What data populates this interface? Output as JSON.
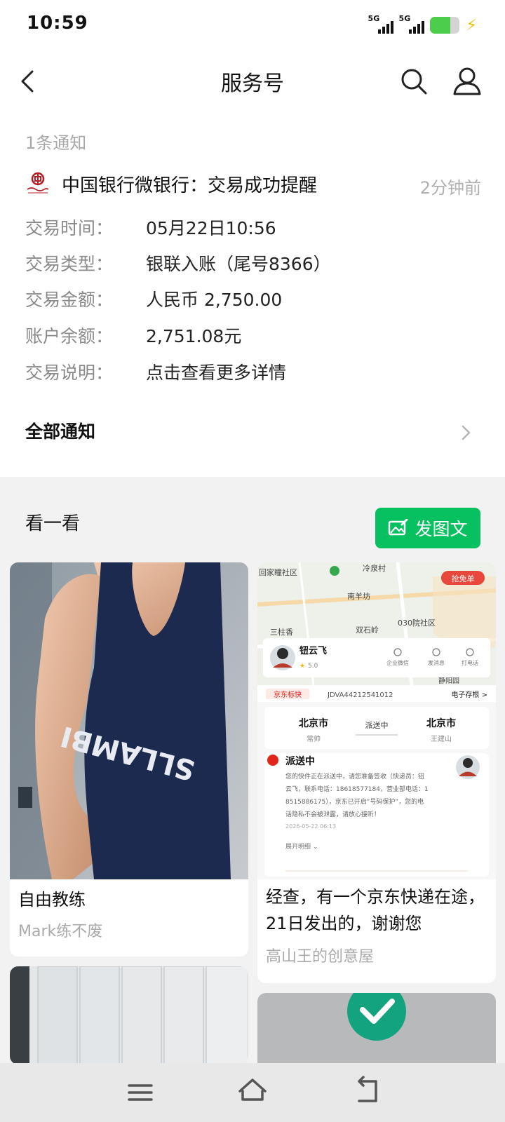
{
  "status_bar": {
    "time": "10:59",
    "sim1_label": "5G",
    "sim2_label": "5G",
    "battery_level": 0.7,
    "battery_color": "#4ccd4c",
    "charging_icon": "lightning-bolt-icon"
  },
  "nav": {
    "title": "服务号",
    "back_icon": "back-arrow-icon",
    "search_icon": "search-icon",
    "profile_icon": "person-icon"
  },
  "notifications": {
    "count_label": "1条通知",
    "message": {
      "title": "中国银行微银行：交易成功提醒",
      "time": "2分钟前",
      "logo_icon": "bank-of-china-logo",
      "fields": [
        {
          "key": "交易时间：",
          "value": "05月22日10:56"
        },
        {
          "key": "交易类型：",
          "value": "银联入账（尾号8366）"
        },
        {
          "key": "交易金额：",
          "value": "人民币 2,750.00"
        },
        {
          "key": "账户余额：",
          "value": "2,751.08元"
        },
        {
          "key": "交易说明：",
          "value": "点击查看更多详情"
        }
      ]
    },
    "all_label": "全部通知"
  },
  "discover": {
    "title": "看一看",
    "post_button_label": "发图文",
    "accent_color": "#07c160",
    "cards": [
      {
        "title": "自由教练",
        "author": "Mark练不废"
      },
      {
        "title": "经查，有一个京东快递在途，21日发出的，谢谢您",
        "author": "高山王的创意屋"
      }
    ]
  },
  "express_screenshot": {
    "map_labels": [
      "回家瞳社区",
      "冷泉村",
      "南羊坊",
      "双石岭",
      "030院社区",
      "三柱香",
      "静阳园"
    ],
    "courier_name": "钮云飞",
    "courier_rating": "5.0",
    "grab_label": "抢免单",
    "actions": [
      "企业微信",
      "发消息",
      "打电话"
    ],
    "brand": "京东标快",
    "waybill": "JDVA44212541012",
    "e_receipt": "电子存根 >",
    "from_city": "北京市",
    "from_person": "常帅",
    "status_pill": "派送中",
    "to_city": "北京市",
    "to_person": "王建山",
    "status_title": "派送中",
    "status_text_lines": [
      "您的快件正在派送中，请您准备签收（快递员：钮",
      "云飞，联系电话：18618577184，营业部电话：1",
      "8515886175），京东已开启“号码保护”，您的电",
      "话隐私不会被泄露，请放心接听！"
    ],
    "status_time": "2026-05-22 06:13",
    "expand_label": "展开明细 ⌄"
  },
  "bottom_nav": {
    "menu_icon": "menu-icon",
    "home_icon": "home-icon",
    "back_icon": "back-icon"
  }
}
